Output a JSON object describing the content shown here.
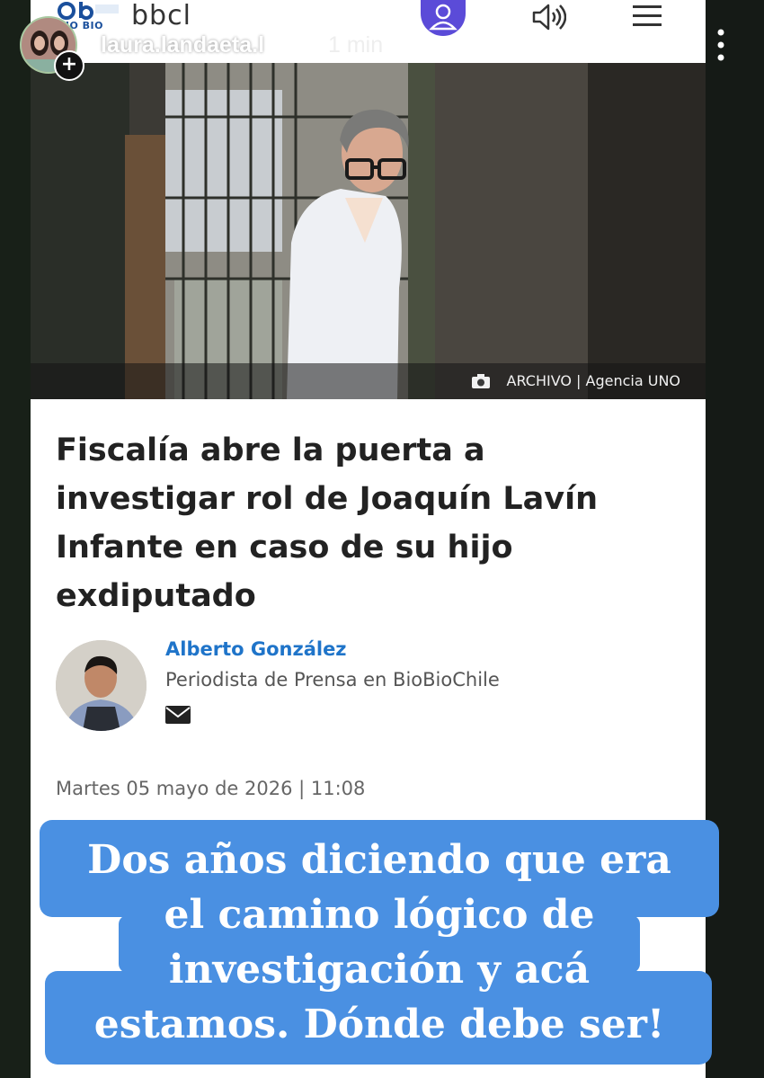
{
  "site": {
    "logo_small": "BIO BIO",
    "logo_text": "bbcl"
  },
  "story": {
    "username": "laura.landaeta.l",
    "time": "1 min",
    "plus": "+"
  },
  "photo": {
    "caption": "ARCHIVO | Agencia UNO"
  },
  "article": {
    "headline": "Fiscalía abre la puerta a investigar rol de Joaquín Lavín Infante en caso de su hijo exdiputado",
    "author_name": "Alberto González",
    "author_role": "Periodista de Prensa en BioBioChile",
    "date": "Martes 05 mayo de 2026 | 11:08"
  },
  "overlay": {
    "line1": "Dos años diciendo que era",
    "line2": "el camino lógico de",
    "line3": "investigación y acá",
    "line4": "estamos. Dónde debe ser!"
  },
  "colors": {
    "accent": "#4a90e2",
    "link": "#1f74c9",
    "user_button": "#5b4bd8"
  }
}
